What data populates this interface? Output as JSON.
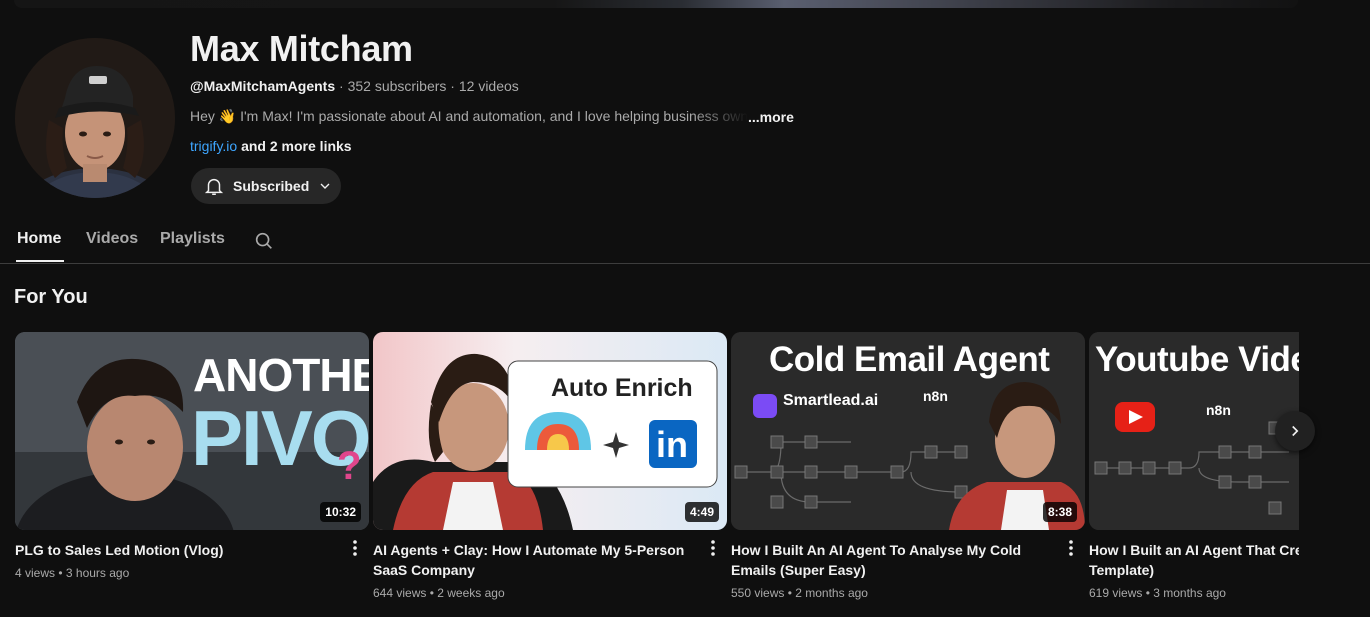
{
  "channel": {
    "name": "Max Mitcham",
    "handle": "@MaxMitchamAgents",
    "subscribers": "352 subscribers",
    "videos": "12 videos",
    "description": "Hey 👋 I'm Max! I'm passionate about AI and automation, and I love helping business owners",
    "more_label": "...more",
    "link": "trigify.io",
    "more_links": "and 2 more links",
    "subscribe_label": "Subscribed"
  },
  "tabs": [
    {
      "label": "Home"
    },
    {
      "label": "Videos"
    },
    {
      "label": "Playlists"
    }
  ],
  "section": {
    "title": "For You"
  },
  "videos": [
    {
      "title": "PLG to Sales Led Motion (Vlog)",
      "duration": "10:32",
      "views": "4 views",
      "age": "3 hours ago",
      "thumb_text": [
        "ANOTHER",
        "PIVOT",
        "?"
      ]
    },
    {
      "title": "AI Agents + Clay: How I Automate My 5-Person SaaS Company",
      "duration": "4:49",
      "views": "644 views",
      "age": "2 weeks ago",
      "thumb_text": [
        "Auto Enrich",
        "in"
      ]
    },
    {
      "title": "How I Built An AI Agent To Analyse My Cold Emails (Super Easy)",
      "duration": "8:38",
      "views": "550 views",
      "age": "2 months ago",
      "thumb_text": [
        "Cold Email Agent",
        "Smartlead.ai",
        "n8n"
      ]
    },
    {
      "title": "How I Built an AI Agent That Creates Ideas (Free Template)",
      "duration": "",
      "views": "619 views",
      "age": "3 months ago",
      "thumb_text": [
        "Youtube Video",
        "n8n"
      ]
    }
  ],
  "colors": {
    "background": "#0f0f0f",
    "link": "#3ea6ff",
    "chip": "#272727"
  }
}
